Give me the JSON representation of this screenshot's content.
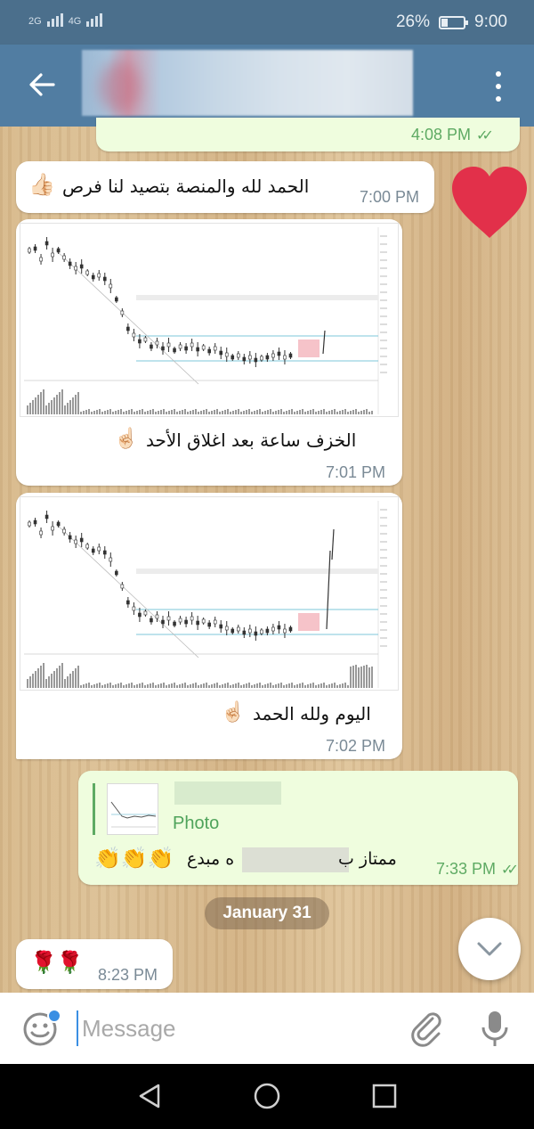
{
  "status_bar": {
    "signal_left": "2G",
    "signal_right": "4G",
    "battery_percent": "26%",
    "time": "9:00"
  },
  "messages": {
    "top_partial_time": "4:08 PM",
    "msg1_text": "الحمد لله والمنصة بتصيد لنا فرص",
    "msg1_time": "7:00 PM",
    "msg2_caption": "الخزف ساعة بعد اغلاق الأحد",
    "msg2_time": "7:01 PM",
    "msg3_caption": "اليوم ولله الحمد",
    "msg3_time": "7:02 PM",
    "reply_label": "Photo",
    "msg4_text_start": "ممتاز ب",
    "msg4_text_end": "ه مبدع",
    "msg4_time": "7:33 PM",
    "date_separator": "January 31",
    "msg5_time": "8:23 PM"
  },
  "composer": {
    "placeholder": "Message"
  },
  "colors": {
    "app_bar": "#517da2",
    "status_bar": "#4b6f8c",
    "outgoing_bubble": "#effdde",
    "incoming_bubble": "#ffffff",
    "heart": "#e2304a",
    "accent": "#3b8fe3"
  }
}
